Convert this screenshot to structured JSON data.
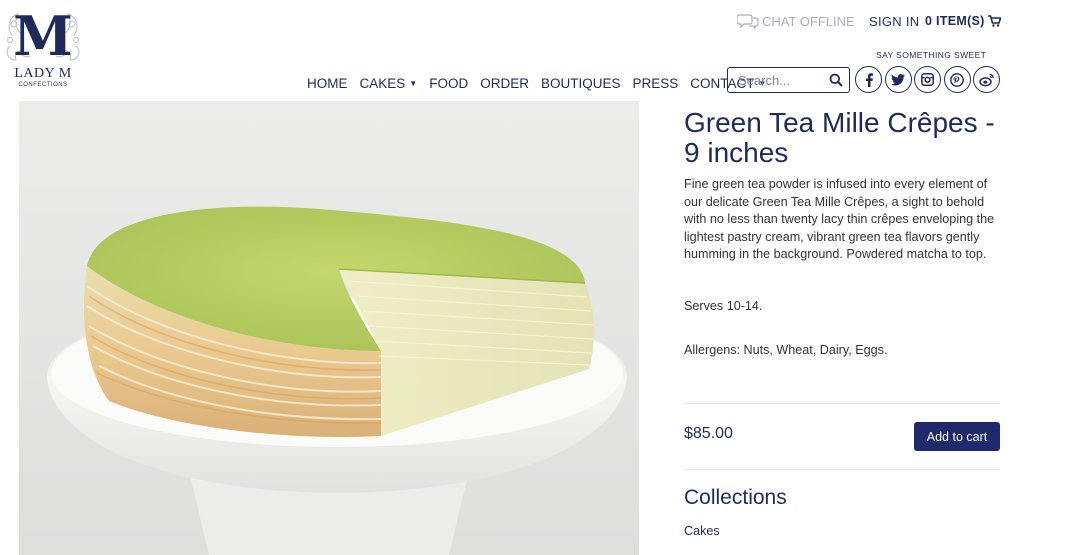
{
  "brand": {
    "logo_letter": "M",
    "name": "LADY M",
    "subtitle": "CONFECTIONS",
    "color": "#1f2a5c"
  },
  "header": {
    "chat_status": "CHAT OFFLINE",
    "sign_in": "SIGN IN",
    "cart": "0 ITEM(S)",
    "tagline": "SAY SOMETHING SWEET"
  },
  "nav": {
    "items": [
      {
        "label": "HOME",
        "dropdown": false
      },
      {
        "label": "CAKES",
        "dropdown": true
      },
      {
        "label": "FOOD",
        "dropdown": false
      },
      {
        "label": "ORDER",
        "dropdown": false
      },
      {
        "label": "BOUTIQUES",
        "dropdown": false
      },
      {
        "label": "PRESS",
        "dropdown": false
      },
      {
        "label": "CONTACT",
        "dropdown": true
      }
    ],
    "caret": "▼"
  },
  "search": {
    "placeholder": "Search..."
  },
  "socials": [
    "facebook-icon",
    "twitter-icon",
    "instagram-icon",
    "pinterest-icon",
    "weibo-icon"
  ],
  "product": {
    "title": "Green Tea Mille Crêpes - 9 inches",
    "description": "Fine green tea powder is infused into every element of our delicate Green Tea Mille Crêpes, a sight to behold with no less than twenty lacy thin crêpes enveloping the lightest pastry cream, vibrant green tea flavors gently humming in the background. Powdered matcha to top.",
    "serves": "Serves 10-14.",
    "allergens": "Allergens: Nuts, Wheat, Dairy, Eggs.",
    "price": "$85.00",
    "add_to_cart": "Add to cart",
    "image": "green-tea-mille-crepe-cake-photo"
  },
  "collections": {
    "heading": "Collections",
    "items": [
      "Cakes"
    ]
  },
  "colors": {
    "accent": "#1f2a5c",
    "button": "#1f2a6c",
    "muted": "#a8adc6",
    "matcha": "#b8cf62"
  }
}
